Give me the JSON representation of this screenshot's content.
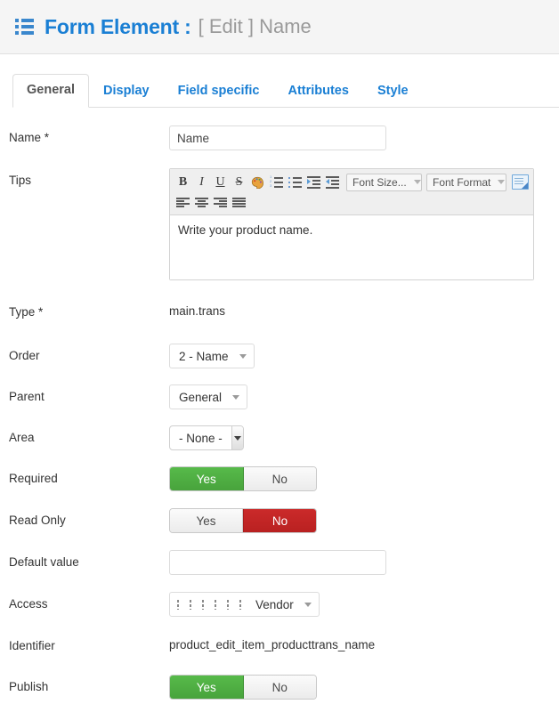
{
  "header": {
    "icon": "list-icon",
    "title": "Form Element :",
    "subtitle": "[ Edit ] Name"
  },
  "tabs": [
    {
      "label": "General",
      "active": true
    },
    {
      "label": "Display",
      "active": false
    },
    {
      "label": "Field specific",
      "active": false
    },
    {
      "label": "Attributes",
      "active": false
    },
    {
      "label": "Style",
      "active": false
    }
  ],
  "form": {
    "name": {
      "label": "Name *",
      "value": "Name"
    },
    "tips": {
      "label": "Tips",
      "content": "Write your product name.",
      "toolbar": {
        "bold": "B",
        "italic": "I",
        "underline": "U",
        "strike": "S",
        "text_color": "text-color-icon",
        "numbered_list": "numbered-list-icon",
        "bulleted_list": "bulleted-list-icon",
        "increase_indent": "increase-indent-icon",
        "decrease_indent": "decrease-indent-icon",
        "font_size": "Font Size...",
        "font_format": "Font Format",
        "source": "source-edit-icon",
        "align_left": "align-left-icon",
        "align_center": "align-center-icon",
        "align_right": "align-right-icon",
        "align_justify": "align-justify-icon"
      }
    },
    "type": {
      "label": "Type *",
      "value": "main.trans"
    },
    "order": {
      "label": "Order",
      "value": "2 - Name"
    },
    "parent": {
      "label": "Parent",
      "value": "General"
    },
    "area": {
      "label": "Area",
      "value": "- None -"
    },
    "required": {
      "label": "Required",
      "yes": "Yes",
      "no": "No",
      "selected": "Yes"
    },
    "read_only": {
      "label": "Read Only",
      "yes": "Yes",
      "no": "No",
      "selected": "No"
    },
    "default_value": {
      "label": "Default value",
      "value": ""
    },
    "access": {
      "label": "Access",
      "value": "Vendor",
      "indent_levels": 6
    },
    "identifier": {
      "label": "Identifier",
      "value": "product_edit_item_producttrans_name"
    },
    "publish": {
      "label": "Publish",
      "yes": "Yes",
      "no": "No",
      "selected": "Yes"
    }
  },
  "colors": {
    "brand_blue": "#1a7fd4",
    "header_bg": "#f5f5f5",
    "toggle_green": "#48a33c",
    "toggle_red": "#b92121",
    "muted_text": "#9a9a9a"
  }
}
